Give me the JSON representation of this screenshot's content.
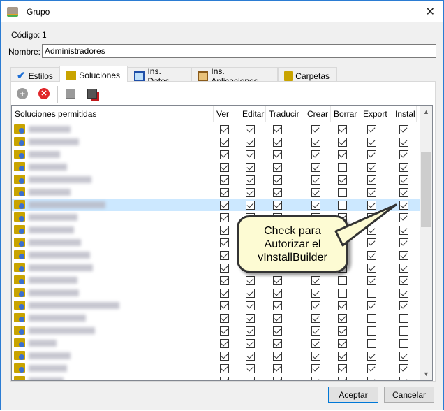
{
  "window": {
    "title": "Grupo",
    "close_label": "✕"
  },
  "form": {
    "codigo_label": "Código:",
    "codigo_value": "1",
    "nombre_label": "Nombre:",
    "nombre_value": "Administradores"
  },
  "tabs": [
    {
      "label": "Estilos"
    },
    {
      "label": "Soluciones"
    },
    {
      "label": "Ins. Datos"
    },
    {
      "label": "Ins. Aplicaciones"
    },
    {
      "label": "Carpetas"
    }
  ],
  "toolbar": [
    "add-icon",
    "remove-icon",
    "add-list-icon",
    "remove-list-icon"
  ],
  "grid": {
    "columns": [
      "Soluciones permitidas",
      "Ver",
      "Editar",
      "Traducir",
      "Crear",
      "Borrar",
      "Export",
      "Instal"
    ],
    "selected_row": 6,
    "rows": [
      [
        1,
        1,
        1,
        1,
        1,
        1,
        1
      ],
      [
        1,
        1,
        1,
        1,
        1,
        1,
        1
      ],
      [
        1,
        1,
        1,
        1,
        1,
        1,
        1
      ],
      [
        1,
        1,
        1,
        1,
        0,
        1,
        1
      ],
      [
        1,
        1,
        1,
        1,
        1,
        1,
        1
      ],
      [
        1,
        1,
        1,
        1,
        0,
        1,
        1
      ],
      [
        1,
        1,
        1,
        1,
        0,
        1,
        1
      ],
      [
        1,
        1,
        1,
        1,
        1,
        1,
        1
      ],
      [
        1,
        1,
        1,
        1,
        1,
        1,
        1
      ],
      [
        1,
        1,
        1,
        1,
        1,
        1,
        1
      ],
      [
        1,
        1,
        1,
        1,
        1,
        1,
        1
      ],
      [
        1,
        1,
        1,
        1,
        1,
        1,
        1
      ],
      [
        1,
        1,
        1,
        1,
        0,
        1,
        1
      ],
      [
        1,
        1,
        1,
        1,
        0,
        0,
        1
      ],
      [
        1,
        1,
        1,
        1,
        1,
        1,
        1
      ],
      [
        1,
        1,
        1,
        1,
        1,
        0,
        0
      ],
      [
        1,
        1,
        1,
        1,
        1,
        0,
        0
      ],
      [
        1,
        1,
        1,
        1,
        1,
        0,
        0
      ],
      [
        1,
        1,
        1,
        1,
        1,
        1,
        1
      ],
      [
        1,
        1,
        1,
        1,
        1,
        1,
        1
      ],
      [
        1,
        1,
        1,
        1,
        1,
        1,
        1
      ]
    ]
  },
  "callout": {
    "line1": "Check para",
    "line2": "Autorizar el",
    "line3": "vInstallBuilder"
  },
  "buttons": {
    "accept": "Aceptar",
    "cancel": "Cancelar"
  }
}
